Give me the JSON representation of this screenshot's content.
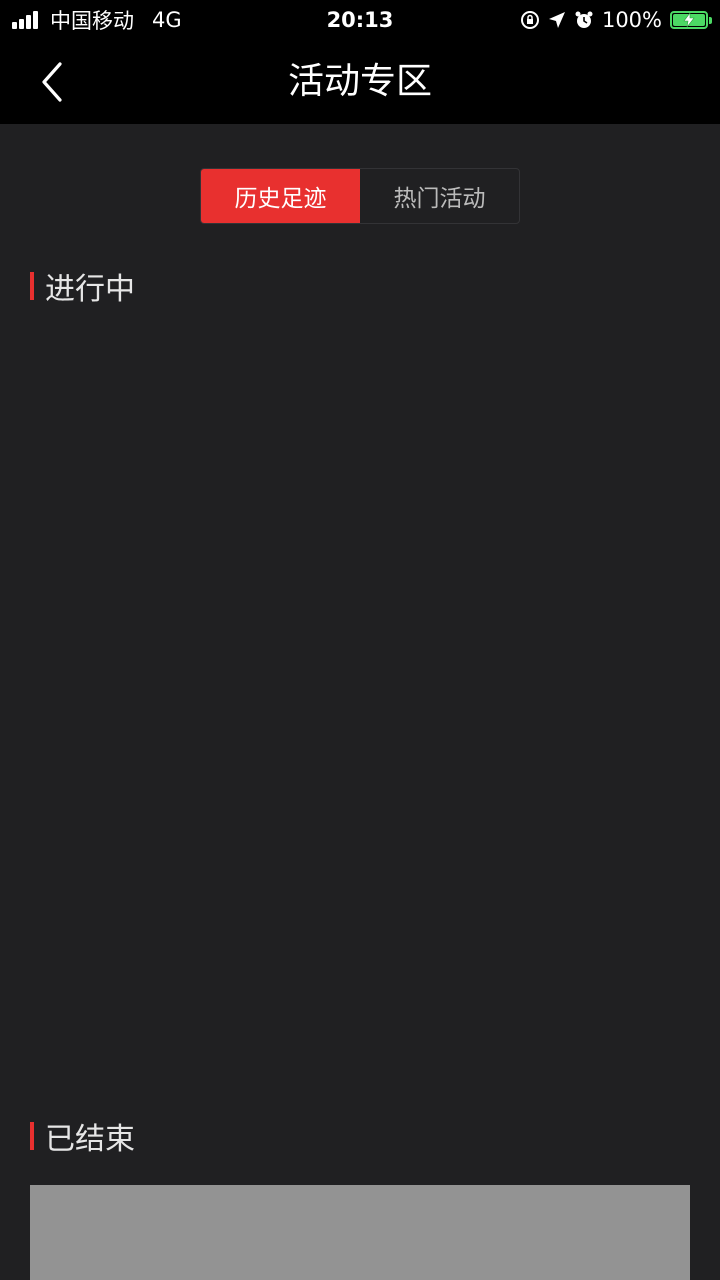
{
  "status_bar": {
    "carrier": "中国移动",
    "network": "4G",
    "time": "20:13",
    "battery": "100%",
    "icons": [
      "signal-icon",
      "orientation-lock-icon",
      "location-icon",
      "alarm-icon",
      "battery-charging-icon"
    ]
  },
  "nav": {
    "title": "活动专区",
    "back_icon": "chevron-left-icon"
  },
  "tabs": [
    {
      "label": "历史足迹",
      "active": true
    },
    {
      "label": "热门活动",
      "active": false
    }
  ],
  "sections": {
    "ongoing": {
      "title": "进行中"
    },
    "ended": {
      "title": "已结束"
    }
  },
  "colors": {
    "accent": "#e8302f",
    "background": "#202022",
    "header": "#000000",
    "card_placeholder": "#939393"
  }
}
